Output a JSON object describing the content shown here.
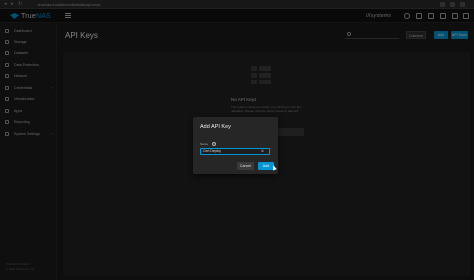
{
  "browser": {
    "url": "truenas.local/#/credentials/api-keys",
    "back": "◂",
    "forward": "▸",
    "reload": "↻"
  },
  "topbar": {
    "logo_main": "True",
    "logo_accent": "NAS",
    "brand_right": "iXsystems"
  },
  "sidebar": {
    "items": [
      {
        "label": "Dashboard"
      },
      {
        "label": "Storage"
      },
      {
        "label": "Datasets"
      },
      {
        "label": "Data Protection"
      },
      {
        "label": "Network"
      },
      {
        "label": "Credentials",
        "has_children": true
      },
      {
        "label": "Virtualization"
      },
      {
        "label": "Apps"
      },
      {
        "label": "Reporting"
      },
      {
        "label": "System Settings",
        "has_children": true
      }
    ],
    "footer_line1": "TrueNAS SCALE ®",
    "footer_line2": "© 2023 iXsystems, Inc."
  },
  "main": {
    "title": "API Keys",
    "columns_label": "Columns",
    "add_label": "Add",
    "docs_label": "API Docs",
    "empty_title": "No API Keys",
    "empty_desc": "The system could not retrieve any API Keys from the database. Please click the button below to add API."
  },
  "dialog": {
    "title": "Add API Key",
    "name_label": "Name",
    "help_glyph": "?",
    "name_value": "Cert Deploy",
    "clear_glyph": "⊗",
    "cancel_label": "Cancel",
    "add_label": "Add"
  },
  "colors": {
    "accent": "#0095d5",
    "background": "#1a1a1a"
  }
}
